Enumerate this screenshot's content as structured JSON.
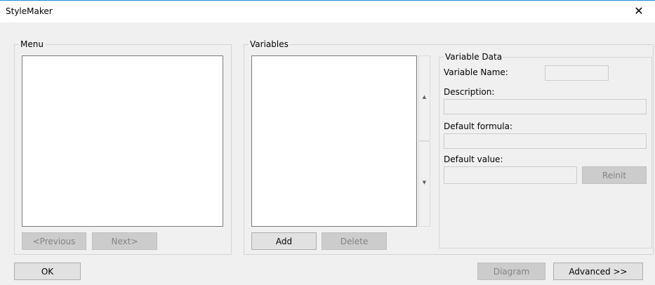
{
  "window": {
    "title": "StyleMaker",
    "close_glyph": "✕"
  },
  "menu_group": {
    "legend": "Menu",
    "prev_label": "<Previous",
    "next_label": "Next>"
  },
  "variables_group": {
    "legend": "Variables",
    "add_label": "Add",
    "delete_label": "Delete",
    "scroll_up_glyph": "▲",
    "scroll_down_glyph": "▼"
  },
  "variable_data": {
    "legend": "Variable Data",
    "name_label": "Variable Name:",
    "description_label": "Description:",
    "formula_label": "Default formula:",
    "value_label": "Default value:",
    "reinit_label": "Reinit"
  },
  "footer": {
    "ok_label": "OK",
    "diagram_label": "Diagram",
    "advanced_label": "Advanced >>"
  }
}
